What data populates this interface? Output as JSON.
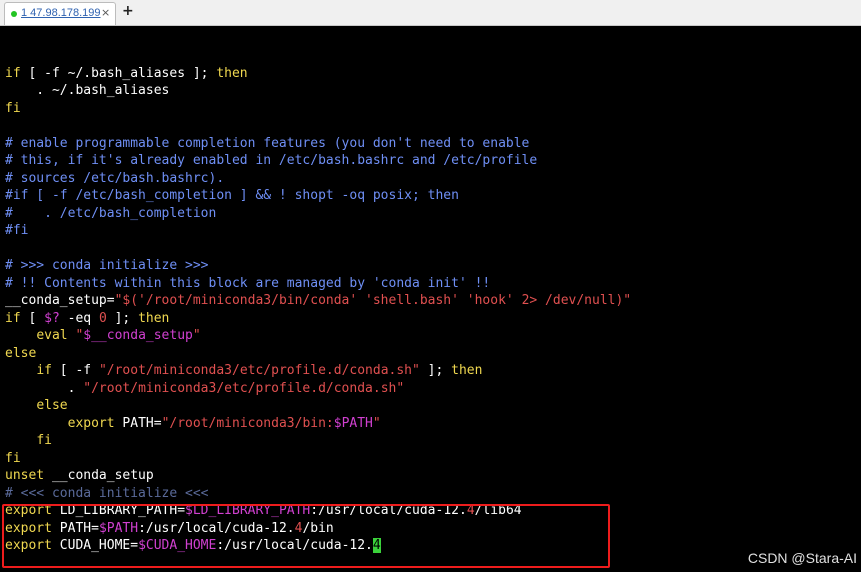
{
  "tab": {
    "label": "1 47.98.178.199",
    "close": "×",
    "add": "+"
  },
  "terminal": {
    "lines": [
      "",
      "if [ -f ~/.bash_aliases ]; then",
      "    . ~/.bash_aliases",
      "fi",
      "",
      "# enable programmable completion features (you don't need to enable",
      "# this, if it's already enabled in /etc/bash.bashrc and /etc/profile",
      "# sources /etc/bash.bashrc).",
      "#if [ -f /etc/bash_completion ] && ! shopt -oq posix; then",
      "#    . /etc/bash_completion",
      "#fi",
      "",
      "# >>> conda initialize >>>",
      "# !! Contents within this block are managed by 'conda init' !!",
      "__conda_setup=\"$('/root/miniconda3/bin/conda' 'shell.bash' 'hook' 2> /dev/null)\"",
      "if [ $? -eq 0 ]; then",
      "    eval \"$__conda_setup\"",
      "else",
      "    if [ -f \"/root/miniconda3/etc/profile.d/conda.sh\" ]; then",
      "        . \"/root/miniconda3/etc/profile.d/conda.sh\"",
      "    else",
      "        export PATH=\"/root/miniconda3/bin:$PATH\"",
      "    fi",
      "fi",
      "unset __conda_setup",
      "# <<< conda initialize <<<",
      "export LD_LIBRARY_PATH=$LD_LIBRARY_PATH:/usr/local/cuda-12.4/lib64",
      "export PATH=$PATH:/usr/local/cuda-12.4/bin",
      "export CUDA_HOME=$CUDA_HOME:/usr/local/cuda-12.4"
    ]
  },
  "watermark": "CSDN @Stara-AI",
  "colors": {
    "keyword": "#f0d850",
    "comment": "#6f8ff5",
    "string": "#e05050",
    "variable": "#d040d0",
    "highlight_box": "#ee1c1c",
    "cursor": "#3bd23b"
  }
}
